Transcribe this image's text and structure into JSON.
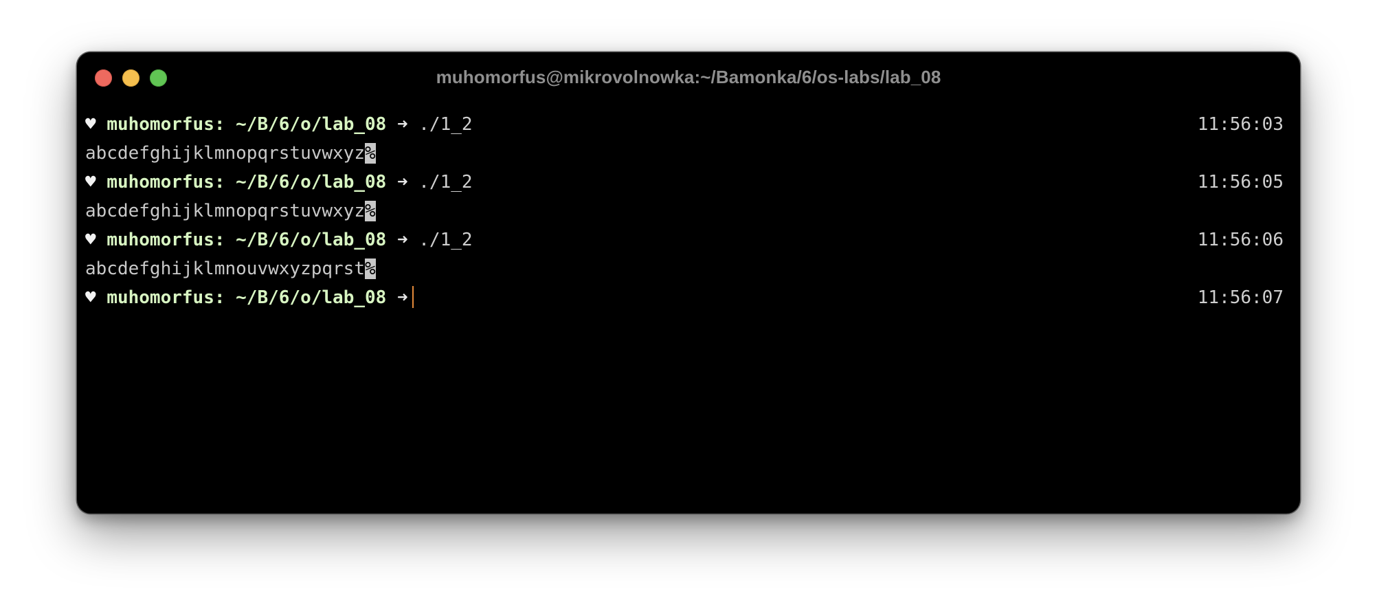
{
  "window": {
    "title": "muhomorfus@mikrovolnowka:~/Bamonka/6/os-labs/lab_08",
    "traffic_lights": {
      "close_color": "#ee6a5f",
      "minimize_color": "#f5bf4f",
      "zoom_color": "#61c554"
    }
  },
  "terminal": {
    "prompt": {
      "symbol": "♥",
      "user": "muhomorfus:",
      "path": "~/B/6/o/lab_08",
      "arrow": "➜",
      "color": "#d8f5c2"
    },
    "entries": [
      {
        "command": "./1_2",
        "time": "11:56:03",
        "output": "abcdefghijklmnopqrstuvwxyz",
        "end_marker": "%"
      },
      {
        "command": "./1_2",
        "time": "11:56:05",
        "output": "abcdefghijklmnopqrstuvwxyz",
        "end_marker": "%"
      },
      {
        "command": "./1_2",
        "time": "11:56:06",
        "output": "abcdefghijklmnouvwxyzpqrst",
        "end_marker": "%"
      }
    ],
    "current": {
      "command": "",
      "time": "11:56:07",
      "cursor_color": "#e48a3a"
    }
  }
}
